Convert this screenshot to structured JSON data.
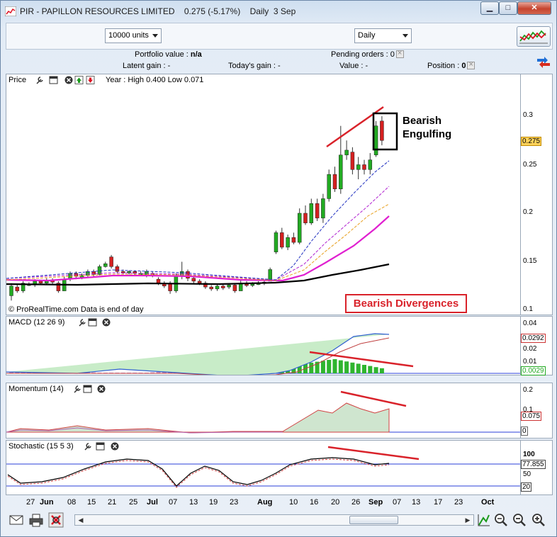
{
  "window": {
    "title": "PIR - PAPILLON RESOURCES LIMITED",
    "price": "0.275 (-5.17%)",
    "period_label": "Daily",
    "date": "3 Sep"
  },
  "toolbar": {
    "units_value": "10000 units",
    "period_value": "Daily"
  },
  "portfolio": {
    "portfolio_value_label": "Portfolio value :",
    "portfolio_value": "n/a",
    "pending_orders_label": "Pending orders :",
    "pending_orders": "0",
    "latent_gain_label": "Latent gain :",
    "latent_gain": "-",
    "todays_gain_label": "Today's gain :",
    "todays_gain": "-",
    "value_label": "Value :",
    "value": "-",
    "position_label": "Position :",
    "position": "0"
  },
  "price_panel": {
    "title": "Price",
    "year_range": "Year : High 0.400 Low 0.071",
    "source_note": "© ProRealTime.com  Data is end of day",
    "ticks": [
      "0.3",
      "0.25",
      "0.2",
      "0.15",
      "0.1"
    ],
    "last_price_tag": "0.275",
    "annotation_1_line1": "Bearish",
    "annotation_1_line2": "Engulfing",
    "annotation_2": "Bearish Divergences"
  },
  "macd_panel": {
    "title": "MACD (12 26 9)",
    "ticks": [
      "0.04",
      "0.02",
      "0.01"
    ],
    "tag_1": "0.0292",
    "tag_2": "0.0029"
  },
  "momentum_panel": {
    "title": "Momentum (14)",
    "ticks": [
      "0.2",
      "0.1"
    ],
    "tag_1": "0.075",
    "tag_2": "0"
  },
  "stochastic_panel": {
    "title": "Stochastic (15 5 3)",
    "ticks": [
      "100",
      "50"
    ],
    "tag_1": "77.855",
    "tag_2": "20"
  },
  "x_axis": {
    "labels": [
      "27",
      "Jun",
      "08",
      "15",
      "21",
      "25",
      "Jul",
      "07",
      "13",
      "19",
      "23",
      "Aug",
      "10",
      "16",
      "20",
      "26",
      "Sep",
      "07",
      "13",
      "17",
      "23",
      "Oct"
    ]
  },
  "colors": {
    "bull": "#22aa22",
    "bear": "#d42020",
    "annotation": "#d9222a",
    "ma_magenta": "#e020d0",
    "ma_long": "#000000"
  }
}
